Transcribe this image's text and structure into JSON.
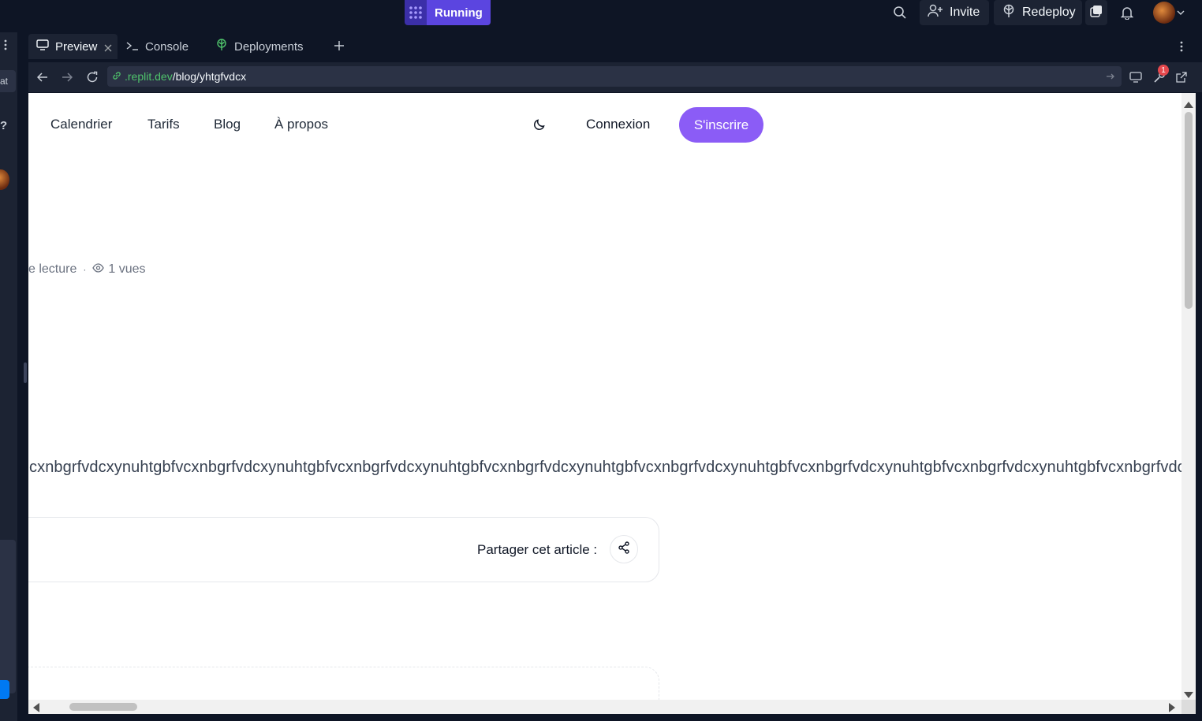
{
  "topbar": {
    "status_label": "Running",
    "invite_label": "Invite",
    "redeploy_label": "Redeploy",
    "notification_count": "1"
  },
  "leftstrip": {
    "frag_top": "at",
    "frag_mid": "?"
  },
  "tabs": [
    {
      "label": "Preview",
      "icon": "monitor-icon",
      "active": true
    },
    {
      "label": "Console",
      "icon": "terminal-icon",
      "active": false
    },
    {
      "label": "Deployments",
      "icon": "deploy-icon",
      "active": false
    }
  ],
  "urlbar": {
    "host": ".replit.dev",
    "path": "/blog/yhtgfvdcx"
  },
  "site": {
    "nav": [
      "Calendrier",
      "Tarifs",
      "Blog",
      "À propos"
    ],
    "login_label": "Connexion",
    "signup_label": "S'inscrire",
    "meta_read": "e lecture",
    "meta_sep": "·",
    "meta_views": "1 vues",
    "body_text": "cxnbgrfvdcxynuhtgbfvcxnbgrfvdcxynuhtgbfvcxnbgrfvdcxynuhtgbfvcxnbgrfvdcxynuhtgbfvcxnbgrfvdcxynuhtgbfvcxnbgrfvdcxynuhtgbfvcxnbgrfvdcxynuhtgbfvcxnbgrfvdcx",
    "share_label": "Partager cet article :"
  },
  "colors": {
    "accent": "#8b5cf6",
    "running": "#5b45e0",
    "url_host": "#4fc36b"
  }
}
